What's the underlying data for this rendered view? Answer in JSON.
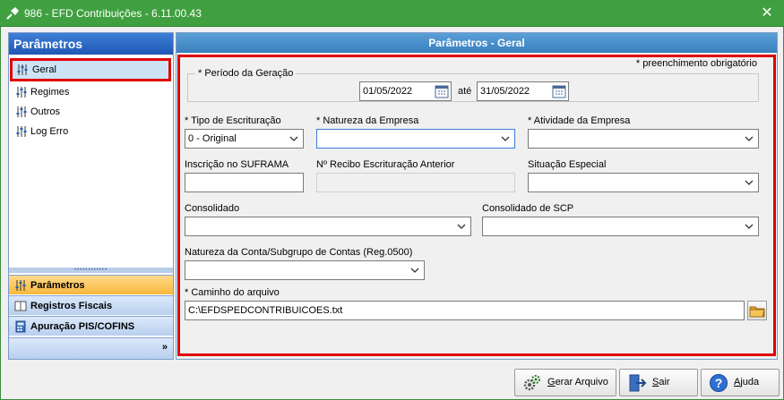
{
  "window": {
    "title": "986 - EFD Contribuições - 6.11.00.43"
  },
  "sidebar": {
    "title": "Parâmetros",
    "items": [
      {
        "label": "Geral"
      },
      {
        "label": "Regimes"
      },
      {
        "label": "Outros"
      },
      {
        "label": "Log Erro"
      }
    ],
    "groups": [
      {
        "label": "Parâmetros"
      },
      {
        "label": "Registros Fiscais"
      },
      {
        "label": "Apuração PIS/COFINS"
      }
    ]
  },
  "main": {
    "title": "Parâmetros - Geral",
    "required_note": "* preenchimento obrigatório",
    "periodo": {
      "legend": "* Período da Geração",
      "start": "01/05/2022",
      "sep": "até",
      "end": "31/05/2022"
    },
    "tipo_escrituracao": {
      "label": "* Tipo de Escrituração",
      "value": "0 - Original"
    },
    "natureza_empresa": {
      "label": "* Natureza da Empresa",
      "value": ""
    },
    "atividade_empresa": {
      "label": "* Atividade da Empresa",
      "value": ""
    },
    "inscricao_suframa": {
      "label": "Inscrição no SUFRAMA",
      "value": ""
    },
    "recibo_anterior": {
      "label": "Nº Recibo Escrituração Anterior",
      "value": ""
    },
    "situacao_especial": {
      "label": "Situação Especial",
      "value": ""
    },
    "consolidado": {
      "label": "Consolidado",
      "value": ""
    },
    "consolidado_scp": {
      "label": "Consolidado de SCP",
      "value": ""
    },
    "natureza_conta": {
      "label": "Natureza da Conta/Subgrupo de Contas (Reg.0500)",
      "value": ""
    },
    "caminho": {
      "label": "* Caminho do arquivo",
      "value": "C:\\EFDSPEDCONTRIBUICOES.txt"
    }
  },
  "buttons": {
    "gerar": "Gerar Arquivo",
    "sair": "Sair",
    "ajuda": "Ajuda"
  }
}
